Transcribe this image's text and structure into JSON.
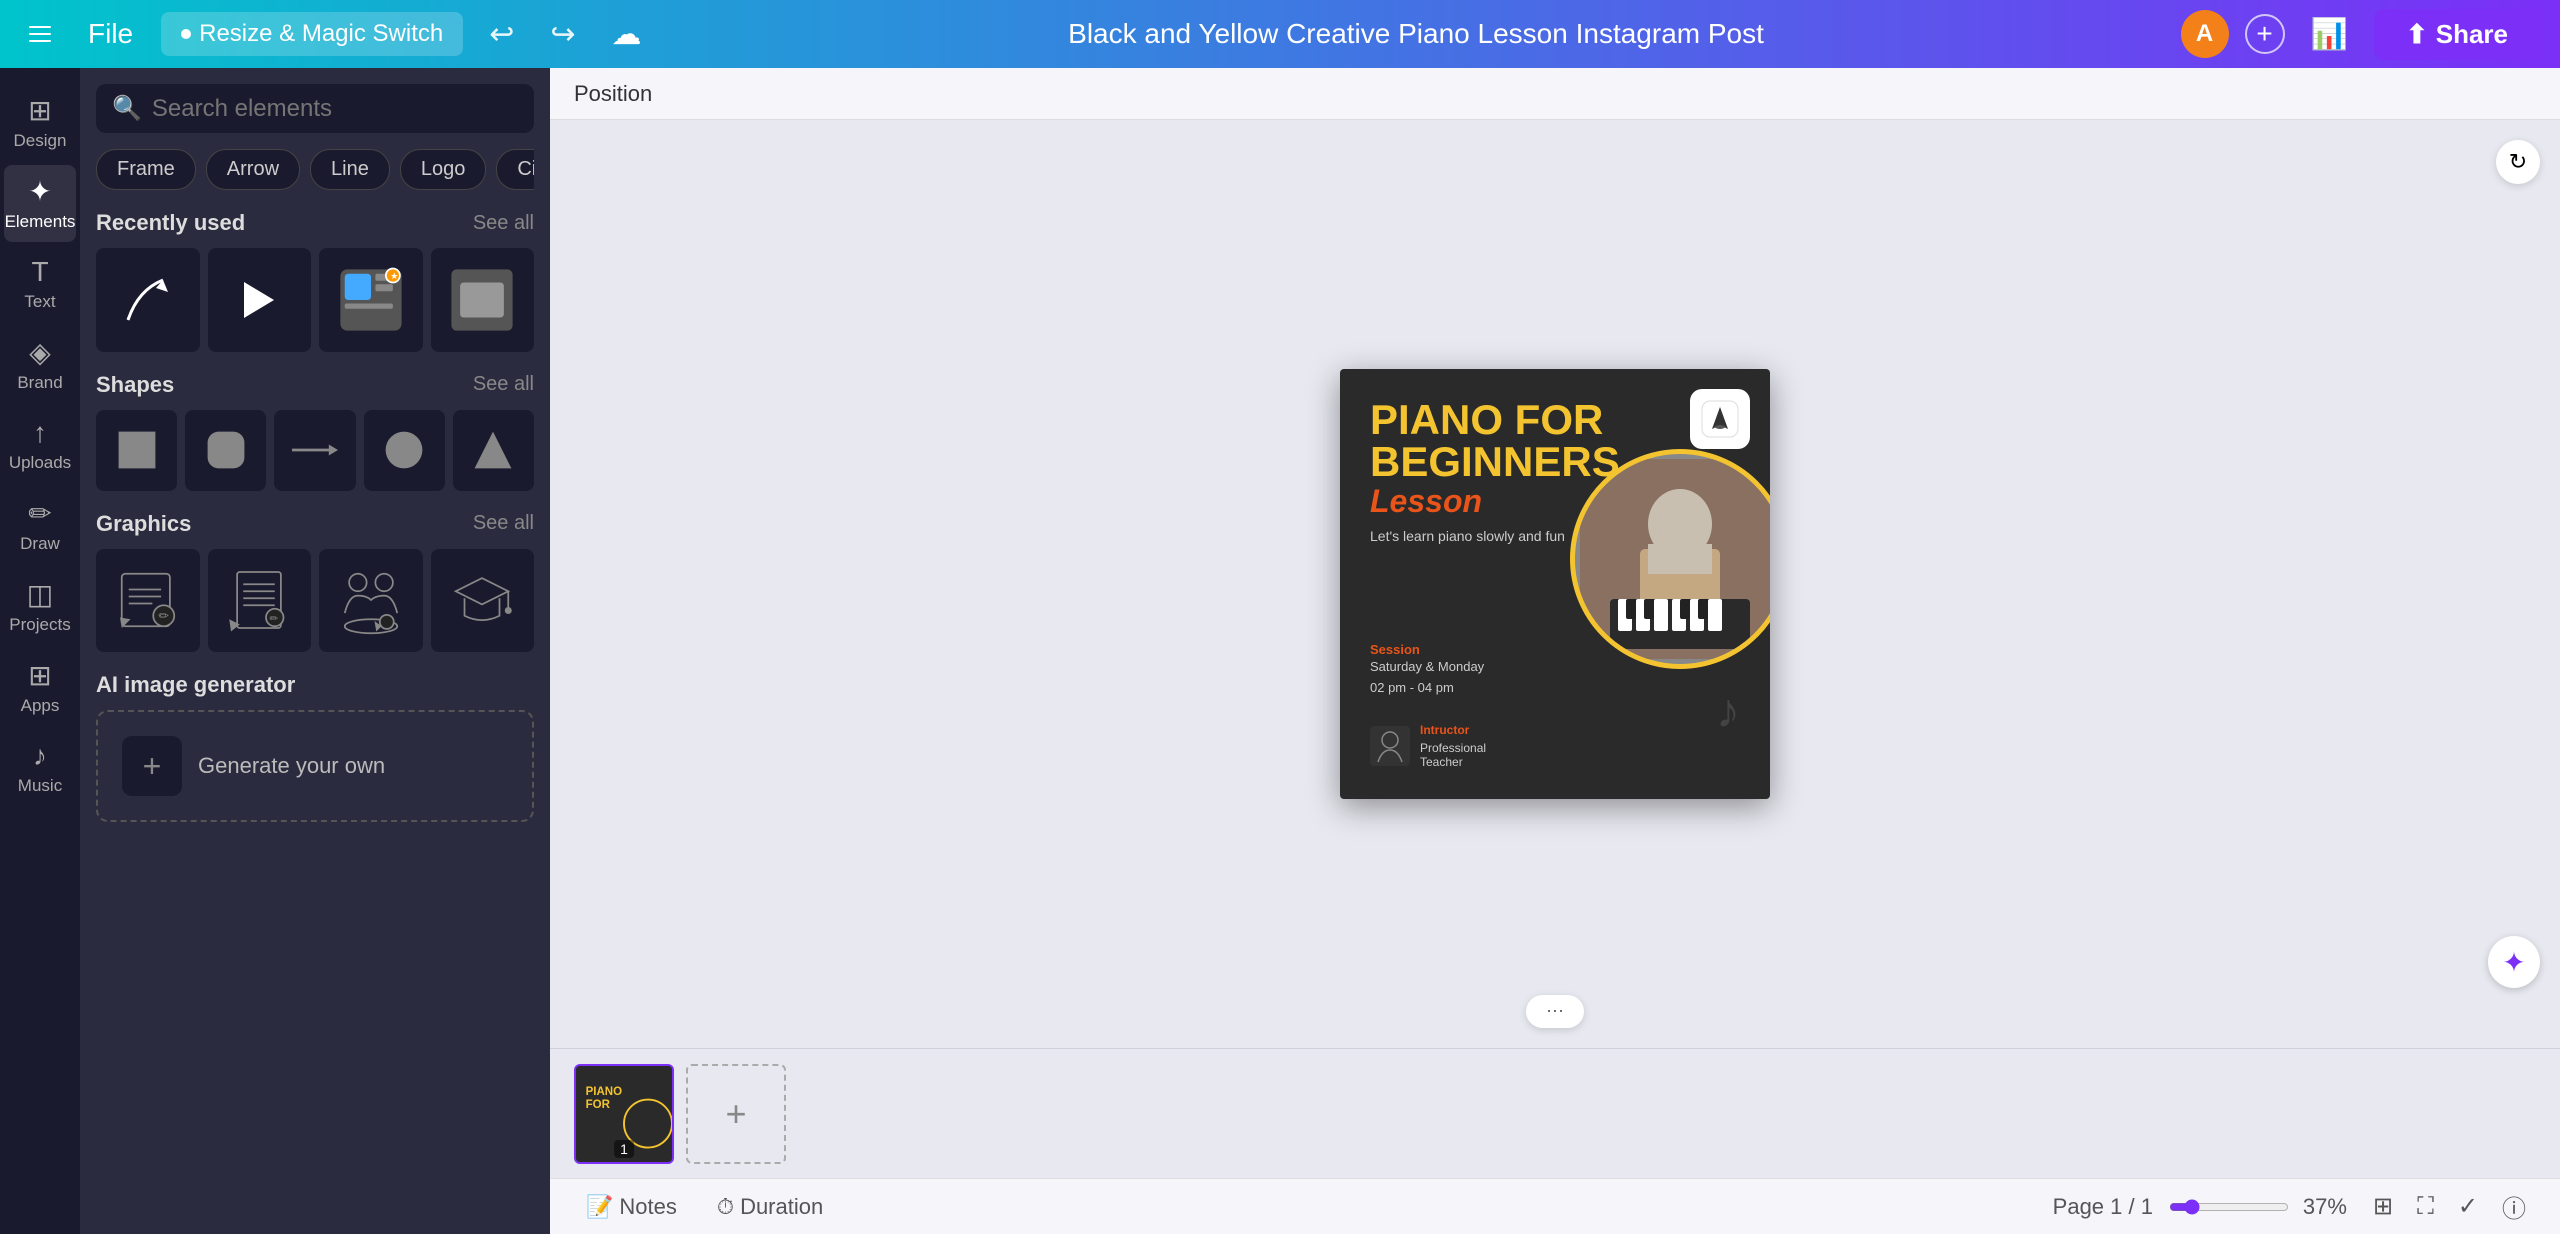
{
  "toolbar": {
    "file_label": "File",
    "magic_switch_label": "Resize & Magic Switch",
    "title": "Black and Yellow Creative Piano Lesson Instagram Post",
    "share_label": "Share",
    "avatar_letter": "A"
  },
  "sidebar": {
    "items": [
      {
        "id": "design",
        "label": "Design",
        "icon": "⊞"
      },
      {
        "id": "elements",
        "label": "Elements",
        "icon": "✦"
      },
      {
        "id": "text",
        "label": "Text",
        "icon": "T"
      },
      {
        "id": "brand",
        "label": "Brand",
        "icon": "◈"
      },
      {
        "id": "uploads",
        "label": "Uploads",
        "icon": "↑"
      },
      {
        "id": "draw",
        "label": "Draw",
        "icon": "✏"
      },
      {
        "id": "projects",
        "label": "Projects",
        "icon": "◫"
      },
      {
        "id": "apps",
        "label": "Apps",
        "icon": "⊞"
      },
      {
        "id": "music",
        "label": "Music",
        "icon": "♪"
      }
    ]
  },
  "panel": {
    "search_placeholder": "Search elements",
    "filter_pills": [
      "Frame",
      "Arrow",
      "Line",
      "Logo",
      "Circle"
    ],
    "recently_used_label": "Recently used",
    "see_all_label": "See all",
    "shapes_label": "Shapes",
    "graphics_label": "Graphics",
    "ai_generator_label": "AI image generator",
    "generate_label": "Generate your own"
  },
  "canvas": {
    "position_label": "Position",
    "design": {
      "title_line1": "PIANO FOR",
      "title_line2": "BEGINNERS",
      "subtitle": "Lesson",
      "tagline": "Let's learn piano slowly and fun",
      "session_label": "Session",
      "session_day": "Saturday & Monday",
      "session_time": "02 pm - 04 pm",
      "instructor_label": "Intructor",
      "instructor_title": "Professional",
      "instructor_role": "Teacher"
    }
  },
  "bottom_bar": {
    "notes_label": "Notes",
    "duration_label": "Duration",
    "page_info": "Page 1 / 1",
    "zoom_level": "37%"
  }
}
